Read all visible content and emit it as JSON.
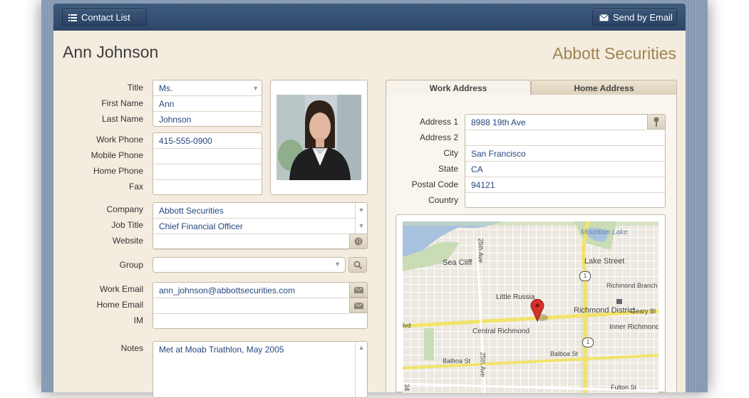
{
  "toolbar": {
    "contacts_label": "Contact List",
    "email_label": "Send by Email"
  },
  "header": {
    "name": "Ann Johnson",
    "company": "Abbott Securities"
  },
  "labels": {
    "title": "Title",
    "first_name": "First Name",
    "last_name": "Last Name",
    "work_phone": "Work Phone",
    "mobile_phone": "Mobile Phone",
    "home_phone": "Home Phone",
    "fax": "Fax",
    "company": "Company",
    "job_title": "Job Title",
    "website": "Website",
    "group": "Group",
    "work_email": "Work Email",
    "home_email": "Home Email",
    "im": "IM",
    "notes": "Notes"
  },
  "values": {
    "title": "Ms.",
    "first_name": "Ann",
    "last_name": "Johnson",
    "work_phone": "415-555-0900",
    "mobile_phone": "",
    "home_phone": "",
    "fax": "",
    "company": "Abbott Securities",
    "job_title": "Chief Financial Officer",
    "website": "",
    "group": "",
    "work_email": "ann_johnson@abbottsecurities.com",
    "home_email": "",
    "im": "",
    "notes": "Met at Moab Triathlon, May 2005"
  },
  "address_tabs": [
    "Work Address",
    "Home Address"
  ],
  "address": {
    "labels": {
      "address1": "Address 1",
      "address2": "Address 2",
      "city": "City",
      "state": "State",
      "postal_code": "Postal Code",
      "country": "Country"
    },
    "values": {
      "address1": "8988 19th Ave",
      "address2": "",
      "city": "San Francisco",
      "state": "CA",
      "postal_code": "94121",
      "country": ""
    }
  },
  "map": {
    "labels": {
      "mountain_lake": "Mountain Lake",
      "lake_street": "Lake Street",
      "sea_cliff": "Sea Cliff",
      "ave_25th": "25th Ave",
      "richmond_branch_library": "Richmond Branch Library",
      "little_russia": "Little Russia",
      "richmond_district": "Richmond District",
      "geary_bl": "Geary Bl",
      "lvd": "lvd",
      "inner_richmond": "Inner Richmond",
      "central_richmond": "Central Richmond",
      "balboa_st_left": "Balboa St",
      "balboa_st_right": "Balboa St",
      "ave_25th_lower": "25th Ave",
      "fulton_st": "Fulton St",
      "ave_34": "34",
      "route_1": "1"
    }
  },
  "colors": {
    "toolbar": "#34506f",
    "content_bg": "#f4ecdf",
    "company_title": "#a08350",
    "field_text": "#27477d"
  }
}
